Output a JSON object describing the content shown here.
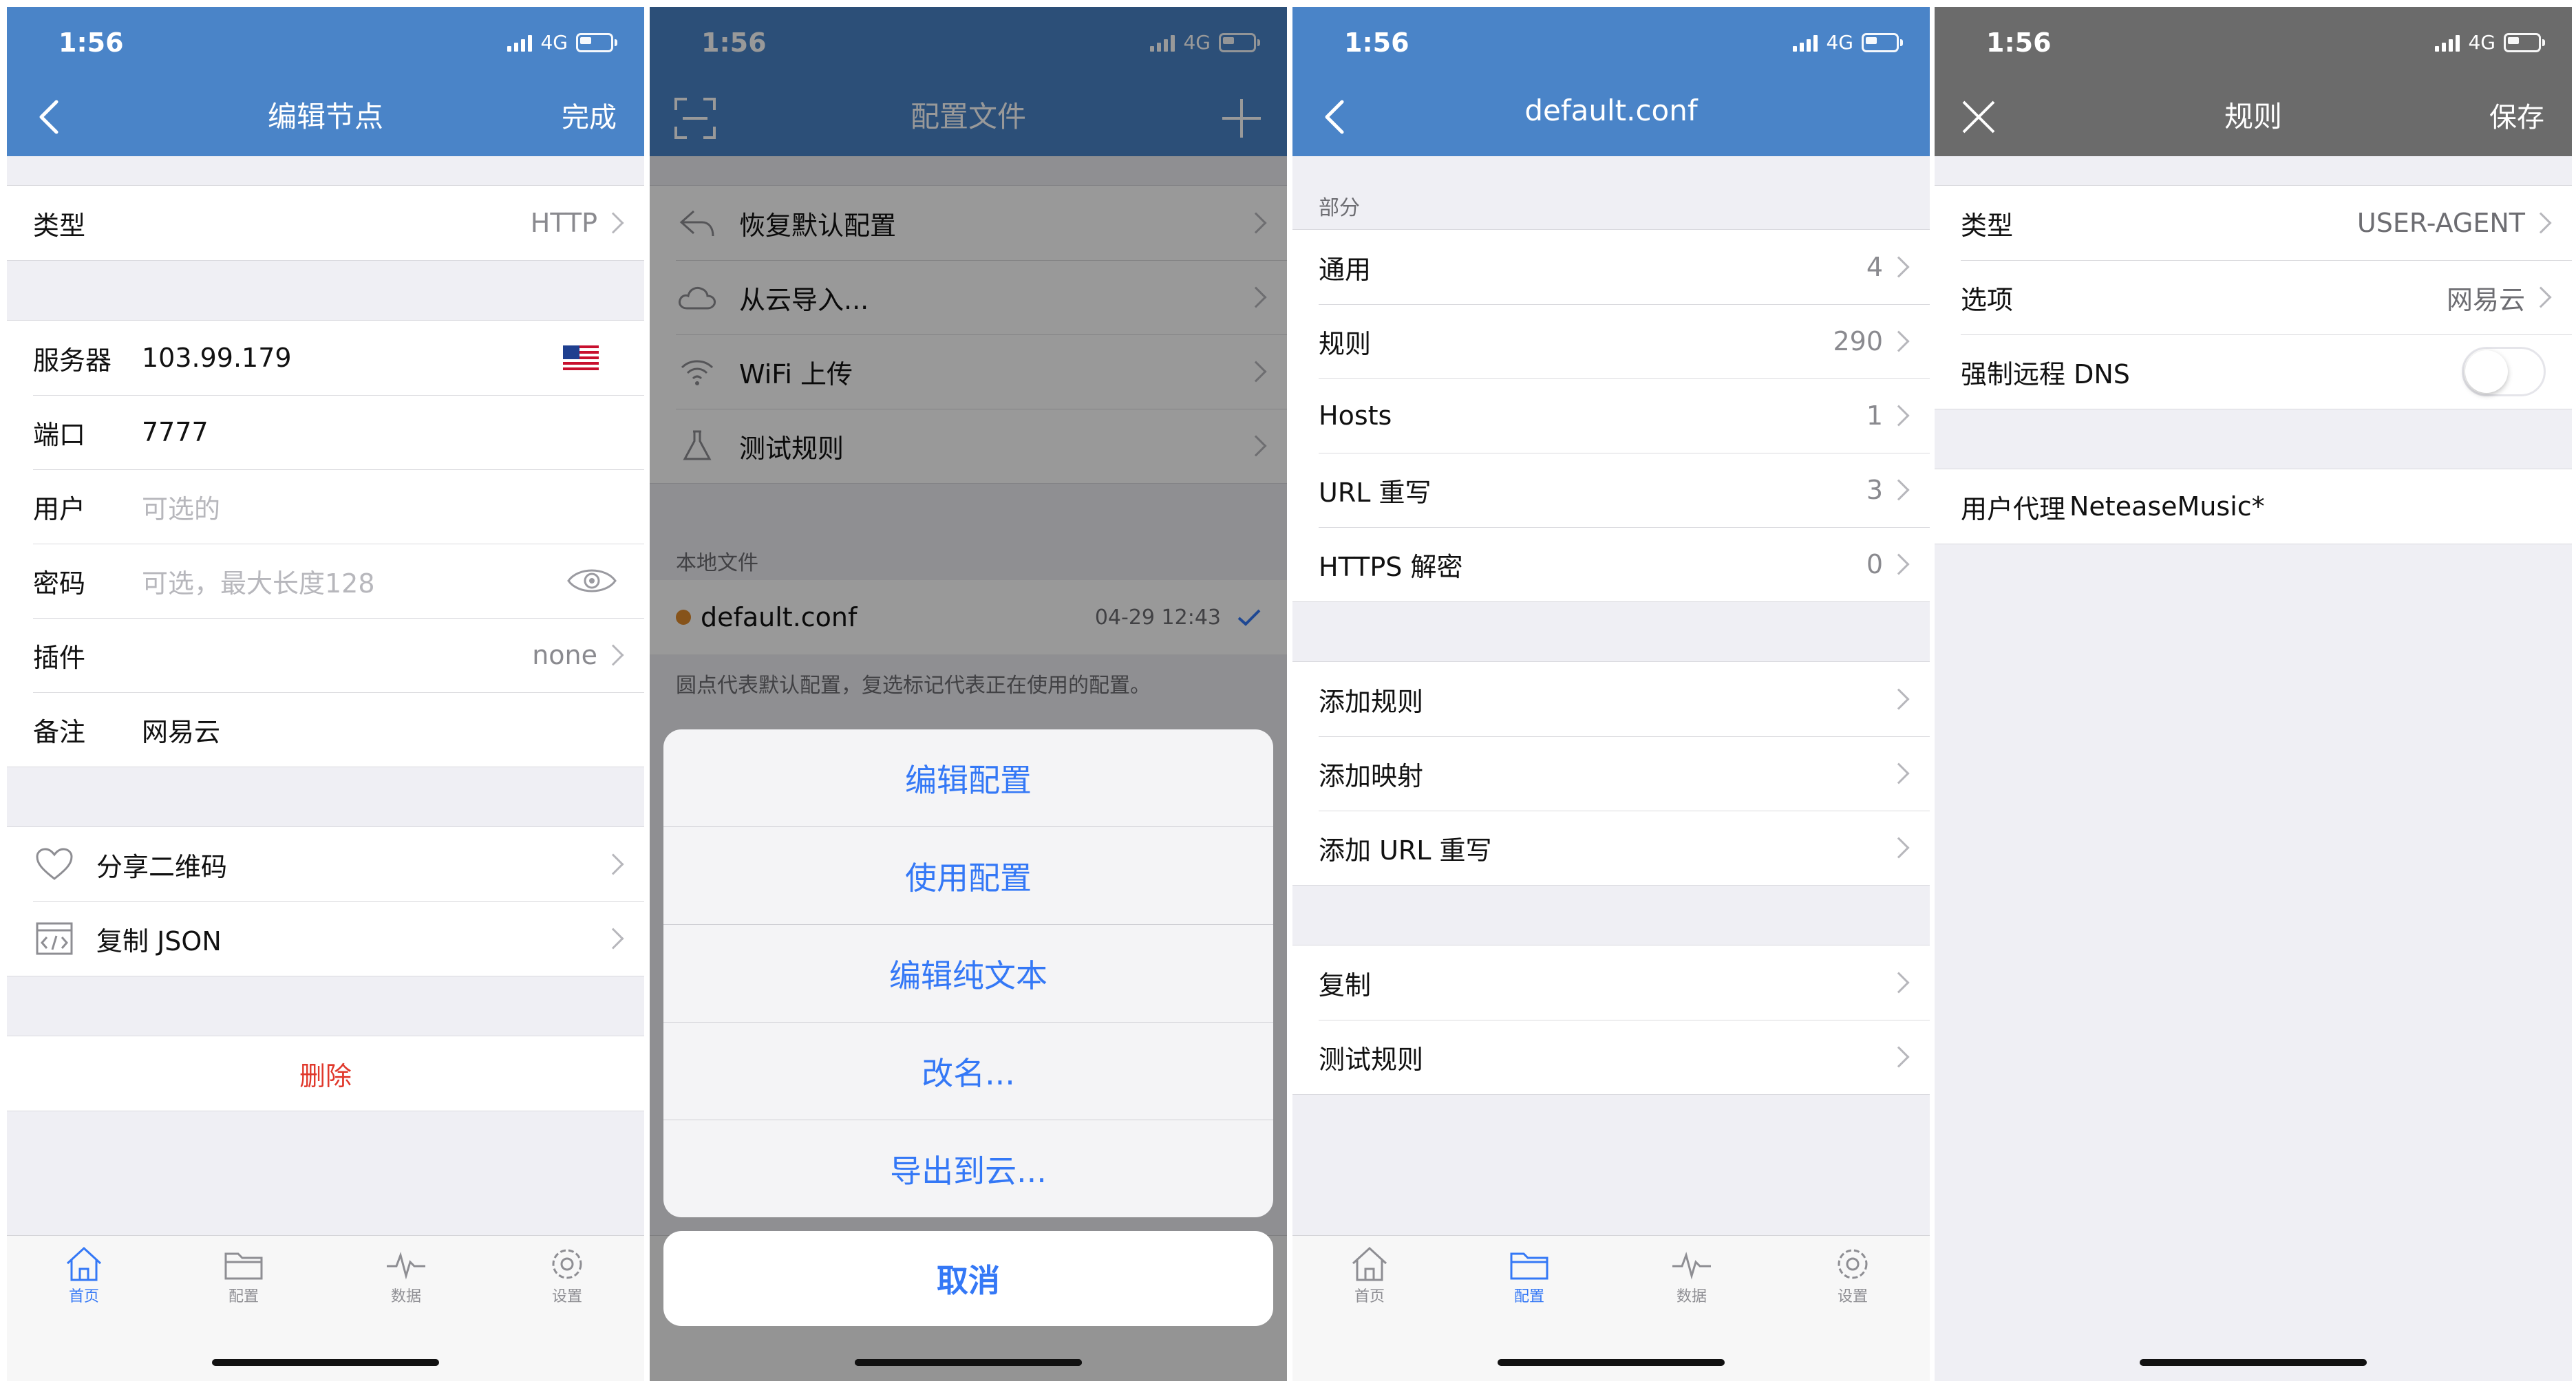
{
  "colors": {
    "nav_blue": "#4a84c8",
    "nav_blue_dim": "#2e4f78",
    "nav_gray": "#6b6b6b",
    "accent": "#3478f6",
    "danger": "#e0382b"
  },
  "status": {
    "time": "1:56",
    "network": "4G"
  },
  "tabs": [
    "首页",
    "配置",
    "数据",
    "设置"
  ],
  "screen1": {
    "back_icon": "chevron-left-icon",
    "title": "编辑节点",
    "done": "完成",
    "type_label": "类型",
    "type_value": "HTTP",
    "server_label": "服务器",
    "server_value": "103.99.179",
    "port_label": "端口",
    "port_value": "7777",
    "user_label": "用户",
    "user_placeholder": "可选的",
    "password_label": "密码",
    "password_placeholder": "可选，最大长度128",
    "plugin_label": "插件",
    "plugin_value": "none",
    "note_label": "备注",
    "note_value": "网易云",
    "share_qr": "分享二维码",
    "copy_json": "复制 JSON",
    "delete": "删除",
    "active_tab": "首页"
  },
  "screen2": {
    "title": "配置文件",
    "menu": [
      "恢复默认配置",
      "从云导入...",
      "WiFi 上传",
      "测试规则"
    ],
    "local_header": "本地文件",
    "file_name": "default.conf",
    "file_time": "04-29 12:43",
    "note": "圆点代表默认配置，复选标记代表正在使用的配置。",
    "sheet_options": [
      "编辑配置",
      "使用配置",
      "编辑纯文本",
      "改名...",
      "导出到云..."
    ],
    "cancel": "取消"
  },
  "screen3": {
    "title": "default.conf",
    "section_header": "部分",
    "sections": [
      {
        "label": "通用",
        "count": "4"
      },
      {
        "label": "规则",
        "count": "290"
      },
      {
        "label": "Hosts",
        "count": "1"
      },
      {
        "label": "URL 重写",
        "count": "3"
      },
      {
        "label": "HTTPS 解密",
        "count": "0"
      }
    ],
    "add_items": [
      "添加规则",
      "添加映射",
      "添加 URL 重写"
    ],
    "other_items": [
      "复制",
      "测试规则"
    ],
    "active_tab": "配置"
  },
  "screen4": {
    "title": "规则",
    "save": "保存",
    "type_label": "类型",
    "type_value": "USER-AGENT",
    "option_label": "选项",
    "option_value": "网易云",
    "dns_label": "强制远程 DNS",
    "dns_on": false,
    "ua_label": "用户代理",
    "ua_value": "NeteaseMusic*"
  }
}
